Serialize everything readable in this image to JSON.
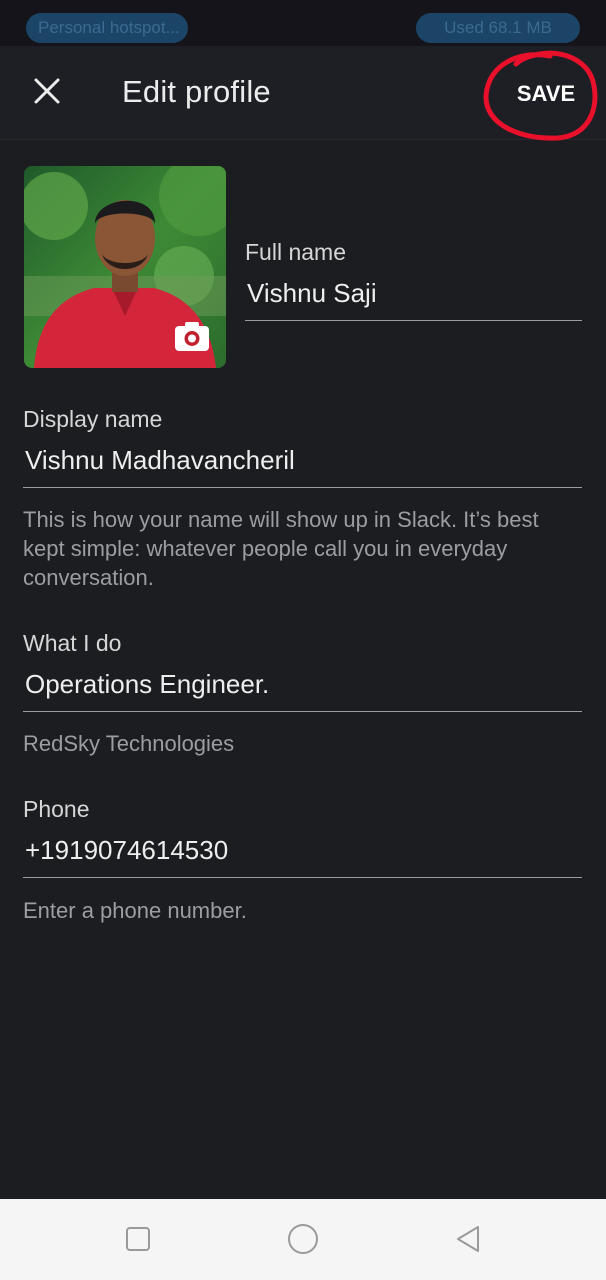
{
  "status_bar": {
    "hotspot_label": "Personal hotspot...",
    "data_usage_label": "Used  68.1 MB"
  },
  "app_bar": {
    "title": "Edit profile",
    "save_label": "SAVE",
    "close_icon": "close-icon"
  },
  "profile": {
    "photo_icon": "avatar-photo",
    "camera_icon": "camera-icon",
    "full_name_label": "Full name",
    "full_name_value": "Vishnu Saji",
    "display_name_label": "Display name",
    "display_name_value": "Vishnu Madhavancheril",
    "display_name_helper": "This is how your name will show up in Slack. It’s best kept simple: whatever people call you in everyday conversation.",
    "what_i_do_label": "What I do",
    "what_i_do_value": "Operations Engineer.",
    "what_i_do_helper": "RedSky Technologies",
    "phone_label": "Phone",
    "phone_value": "+1919074614530",
    "phone_helper": "Enter a phone number."
  },
  "nav_bar": {
    "recents_icon": "square-icon",
    "home_icon": "circle-icon",
    "back_icon": "triangle-back-icon"
  },
  "colors": {
    "background": "#1b1d21",
    "app_bar": "#1d1f24",
    "annotation_circle": "#e8102a",
    "nav_bar": "#f5f5f5"
  }
}
